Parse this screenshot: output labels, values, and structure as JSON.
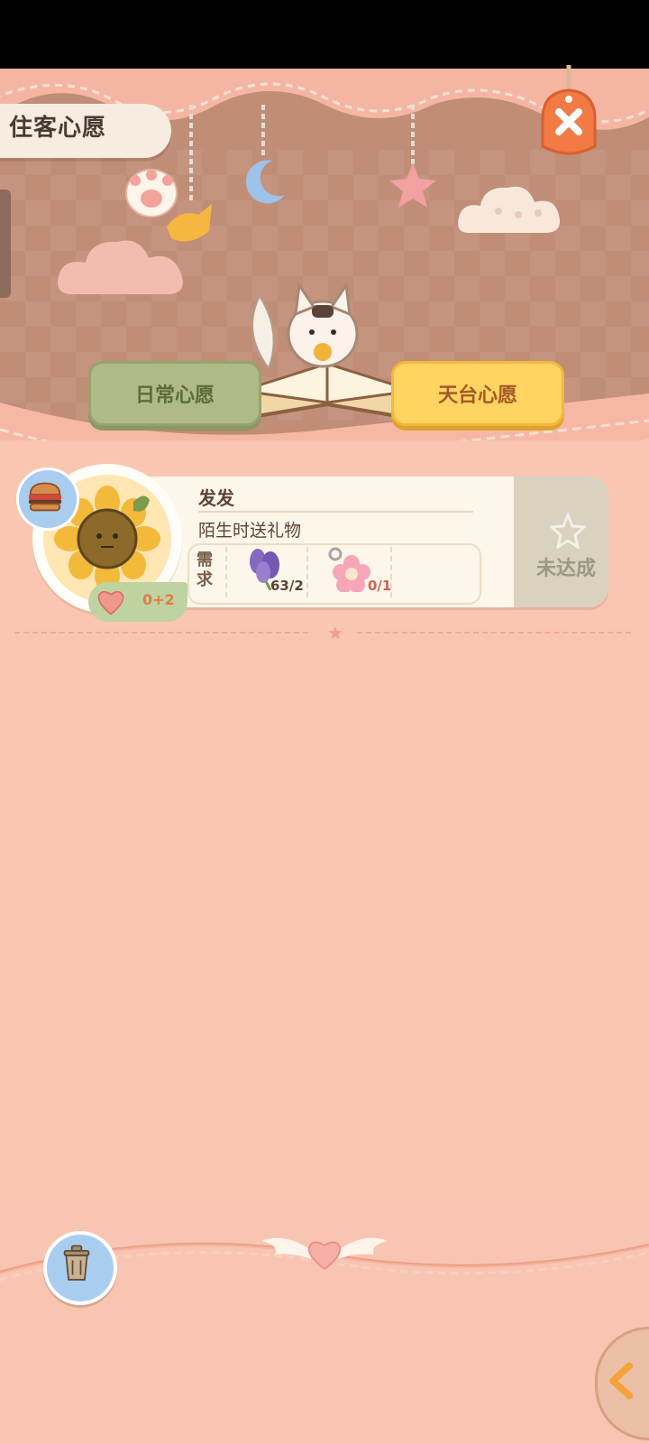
{
  "header": {
    "title": "住客心愿"
  },
  "tabs": [
    {
      "label": "日常心愿",
      "active": false
    },
    {
      "label": "天台心愿",
      "active": true
    }
  ],
  "wish_card": {
    "resident_name": "发发",
    "description": "陌生时送礼物",
    "requirement_label": "需求",
    "items": [
      {
        "icon": "lavender-icon",
        "progress": "63/2"
      },
      {
        "icon": "flower-keychain-icon",
        "progress": "0/1"
      }
    ],
    "heart_value": "0+2",
    "status": "未达成"
  },
  "colors": {
    "background": "#f9c6b2",
    "header": "#c08d76",
    "tab_daily": "#aebb86",
    "tab_roof": "#ffd460",
    "card": "#fdf6ea",
    "status_gray": "#d8d2be"
  }
}
